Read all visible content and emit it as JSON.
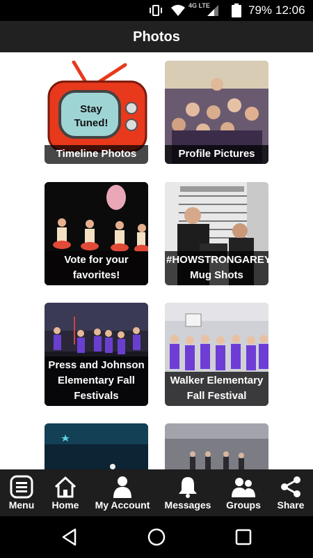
{
  "status_bar": {
    "network": "4G LTE",
    "battery_percent": "79%",
    "time": "12:06"
  },
  "app_bar": {
    "title": "Photos"
  },
  "albums": [
    {
      "caption": "Timeline Photos",
      "thumbnail": "stay-tuned-tv-icon",
      "tv_text": "Stay Tuned!"
    },
    {
      "caption": "Profile Pictures",
      "thumbnail": "dance-group-photo"
    },
    {
      "caption": "Vote for your favorites!",
      "thumbnail": "stage-dancers-photo"
    },
    {
      "caption": "#HOWSTRONGAREYO\nMug Shots",
      "thumbnail": "mug-shot-photo"
    },
    {
      "caption": "Press and Johnson Elementary Fall Festivals",
      "thumbnail": "festival-stage-photo"
    },
    {
      "caption": "Walker Elementary Fall Festival",
      "thumbnail": "gym-dancers-photo"
    },
    {
      "caption": "",
      "thumbnail": "underwater-stage-photo"
    },
    {
      "caption": "",
      "thumbnail": "studio-dancers-photo"
    }
  ],
  "tab_bar": {
    "items": [
      {
        "label": "Menu",
        "icon": "menu-icon"
      },
      {
        "label": "Home",
        "icon": "home-icon"
      },
      {
        "label": "My Account",
        "icon": "account-icon"
      },
      {
        "label": "Messages",
        "icon": "bell-icon"
      },
      {
        "label": "Groups",
        "icon": "groups-icon"
      },
      {
        "label": "Share",
        "icon": "share-icon"
      }
    ]
  },
  "colors": {
    "app_bar": "#212121",
    "tab_bar": "#1e1e1e",
    "content_bg": "#ffffff",
    "caption_bg": "rgba(0,0,0,0.72)"
  }
}
